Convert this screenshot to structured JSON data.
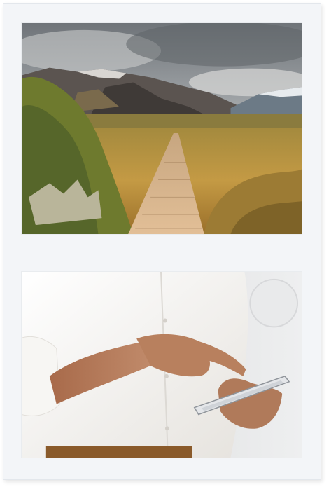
{
  "photos": [
    {
      "subject": "mountain-boardwalk-landscape"
    },
    {
      "subject": "man-in-white-shirt-using-smartphone"
    }
  ],
  "colors": {
    "card_background": "#f3f5f8",
    "sky": "#9aa0a4",
    "mountains": "#5b5450",
    "grass": "#b58a3a",
    "boardwalk": "#d9b48c",
    "shirt": "#f2f0ec",
    "wall": "#e4e5e6",
    "skin": "#b07a5a"
  }
}
